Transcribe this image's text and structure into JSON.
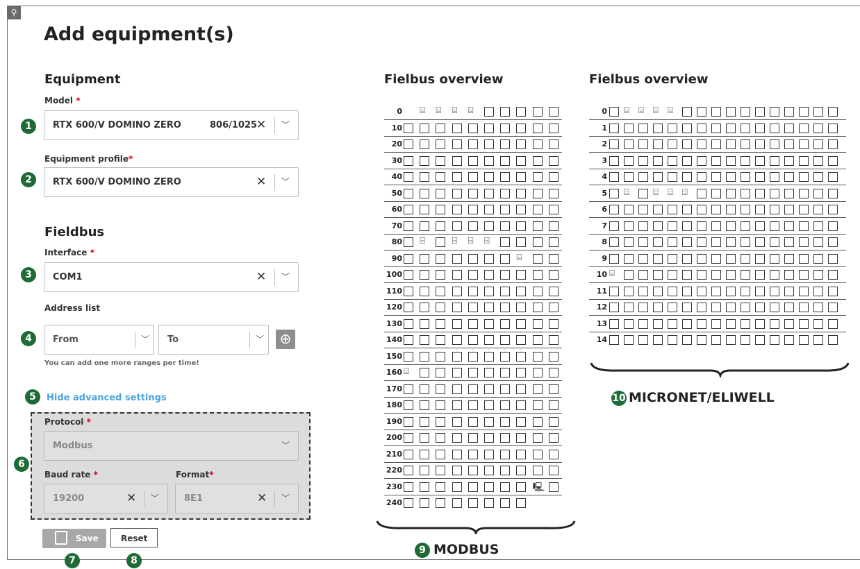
{
  "page": {
    "title": "Add equipment(s)"
  },
  "equipment": {
    "heading": "Equipment",
    "model": {
      "label": "Model",
      "required_mark": "*",
      "value": "RTX 600/V DOMINO ZERO",
      "extra": "806/1025"
    },
    "profile": {
      "label": "Equipment profile",
      "required_mark": "*",
      "value": "RTX 600/V DOMINO ZERO"
    }
  },
  "fieldbus": {
    "heading": "Fieldbus",
    "interface": {
      "label": "Interface",
      "required_mark": "*",
      "value": "COM1"
    },
    "address_list": {
      "label": "Address list",
      "from_placeholder": "From",
      "to_placeholder": "To",
      "hint": "You can add one more ranges per time!"
    },
    "advanced_toggle": "Hide advanced settings",
    "protocol": {
      "label": "Protocol",
      "required_mark": "*",
      "value": "Modbus"
    },
    "baud_rate": {
      "label": "Baud rate",
      "required_mark": "*",
      "value": "19200"
    },
    "format": {
      "label": "Format",
      "required_mark": "*",
      "value": "8E1"
    }
  },
  "actions": {
    "save": "Save",
    "reset": "Reset"
  },
  "badges": [
    "1",
    "2",
    "3",
    "4",
    "5",
    "6",
    "7",
    "8",
    "9",
    "10"
  ],
  "overview_modbus": {
    "title": "Fielbus overview",
    "caption": "MODBUS",
    "rows": [
      {
        "label": "0",
        "cells": [
          "",
          "",
          "",
          "",
          "",
          "",
          "",
          "",
          "",
          ""
        ]
      },
      {
        "label": "10",
        "cells": [
          "",
          "",
          "",
          "",
          "",
          "",
          "",
          "",
          "",
          ""
        ]
      },
      {
        "label": "20",
        "cells": [
          "",
          "",
          "",
          "",
          "",
          "",
          "",
          "",
          "",
          ""
        ]
      },
      {
        "label": "30",
        "cells": [
          "",
          "",
          "",
          "",
          "",
          "",
          "",
          "",
          "",
          ""
        ]
      },
      {
        "label": "40",
        "cells": [
          "",
          "",
          "",
          "",
          "",
          "",
          "",
          "",
          "",
          ""
        ]
      },
      {
        "label": "50",
        "cells": [
          "",
          "",
          "",
          "",
          "",
          "",
          "",
          "",
          "",
          ""
        ]
      },
      {
        "label": "60",
        "cells": [
          "",
          "",
          "",
          "",
          "",
          "",
          "",
          "",
          "",
          ""
        ]
      },
      {
        "label": "70",
        "cells": [
          "",
          "",
          "",
          "",
          "",
          "",
          "",
          "",
          "",
          ""
        ]
      },
      {
        "label": "80",
        "cells": [
          "",
          "",
          "",
          "",
          "",
          "",
          "",
          "",
          "",
          ""
        ]
      },
      {
        "label": "90",
        "cells": [
          "",
          "",
          "",
          "",
          "",
          "",
          "",
          "",
          "",
          ""
        ]
      },
      {
        "label": "100",
        "cells": [
          "",
          "",
          "",
          "",
          "",
          "",
          "",
          "",
          "",
          ""
        ]
      },
      {
        "label": "110",
        "cells": [
          "",
          "",
          "",
          "",
          "",
          "",
          "",
          "",
          "",
          ""
        ]
      },
      {
        "label": "120",
        "cells": [
          "",
          "",
          "",
          "",
          "",
          "",
          "",
          "",
          "",
          ""
        ]
      },
      {
        "label": "130",
        "cells": [
          "",
          "",
          "",
          "",
          "",
          "",
          "",
          "",
          "",
          ""
        ]
      },
      {
        "label": "140",
        "cells": [
          "",
          "",
          "",
          "",
          "",
          "",
          "",
          "",
          "",
          ""
        ]
      },
      {
        "label": "150",
        "cells": [
          "",
          "",
          "",
          "",
          "",
          "",
          "",
          "",
          "",
          ""
        ]
      },
      {
        "label": "160",
        "cells": [
          "",
          "",
          "",
          "",
          "",
          "",
          "",
          "",
          "",
          ""
        ]
      },
      {
        "label": "170",
        "cells": [
          "",
          "",
          "",
          "",
          "",
          "",
          "",
          "",
          "",
          ""
        ]
      },
      {
        "label": "180",
        "cells": [
          "",
          "",
          "",
          "",
          "",
          "",
          "",
          "",
          "",
          ""
        ]
      },
      {
        "label": "190",
        "cells": [
          "",
          "",
          "",
          "",
          "",
          "",
          "",
          "",
          "",
          ""
        ]
      },
      {
        "label": "200",
        "cells": [
          "",
          "",
          "",
          "",
          "",
          "",
          "",
          "",
          "",
          ""
        ]
      },
      {
        "label": "210",
        "cells": [
          "",
          "",
          "",
          "",
          "",
          "",
          "",
          "",
          "",
          ""
        ]
      },
      {
        "label": "220",
        "cells": [
          "",
          "",
          "",
          "",
          "",
          "",
          "",
          "",
          "",
          ""
        ]
      },
      {
        "label": "230",
        "cells": [
          "",
          "",
          "",
          "",
          "",
          "",
          "",
          "",
          "",
          ""
        ]
      },
      {
        "label": "240",
        "cells": [
          "",
          "",
          "",
          "",
          "",
          "",
          "",
          ""
        ]
      }
    ]
  },
  "overview_micronet": {
    "title": "Fielbus overview",
    "caption": "MICRONET/ELIWELL",
    "rows": [
      {
        "label": "0"
      },
      {
        "label": "1"
      },
      {
        "label": "2"
      },
      {
        "label": "3"
      },
      {
        "label": "4"
      },
      {
        "label": "5"
      },
      {
        "label": "6"
      },
      {
        "label": "7"
      },
      {
        "label": "8"
      },
      {
        "label": "9"
      },
      {
        "label": "10"
      },
      {
        "label": "11"
      },
      {
        "label": "12"
      },
      {
        "label": "13"
      },
      {
        "label": "14"
      }
    ]
  },
  "device_markers": {
    "modbus": [
      {
        "row": 0,
        "cols": [
          1,
          2,
          3,
          4
        ],
        "type": "device"
      },
      {
        "row": 8,
        "cols": [
          1,
          3,
          4,
          5
        ],
        "type": "device"
      },
      {
        "row": 9,
        "cols": [
          7
        ],
        "type": "device"
      },
      {
        "row": 16,
        "cols": [
          0
        ],
        "type": "device"
      },
      {
        "row": 23,
        "cols": [
          8
        ],
        "type": "terminal"
      }
    ],
    "micronet": [
      {
        "row": 0,
        "cols": [
          1,
          2,
          3,
          4
        ]
      },
      {
        "row": 5,
        "cols": [
          1,
          3,
          4,
          5
        ]
      },
      {
        "row": 10,
        "cols": [
          0
        ]
      }
    ]
  }
}
